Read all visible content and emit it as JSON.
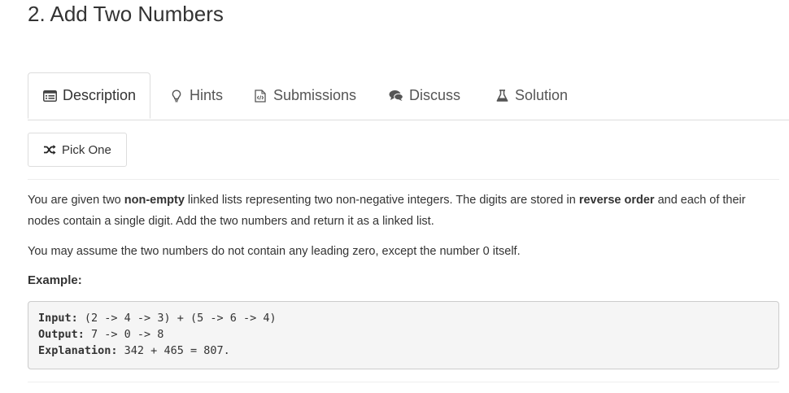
{
  "problem": {
    "title": "2. Add Two Numbers"
  },
  "tabs": [
    {
      "label": "Description",
      "icon": "list-icon",
      "active": true
    },
    {
      "label": "Hints",
      "icon": "lightbulb-icon"
    },
    {
      "label": "Submissions",
      "icon": "code-file-icon"
    },
    {
      "label": "Discuss",
      "icon": "chat-icon"
    },
    {
      "label": "Solution",
      "icon": "flask-icon"
    }
  ],
  "pick_one": {
    "label": "Pick One",
    "icon": "shuffle-icon"
  },
  "description": {
    "p1_a": "You are given two ",
    "p1_b": "non-empty",
    "p1_c": " linked lists representing two non-negative integers. The digits are stored in ",
    "p1_d": "reverse order",
    "p1_e": " and each of their nodes contain a single digit. Add the two numbers and return it as a linked list.",
    "p2": "You may assume the two numbers do not contain any leading zero, except the number 0 itself.",
    "example_heading": "Example:",
    "example": {
      "input_label": "Input:",
      "input_value": " (2 -> 4 -> 3) + (5 -> 6 -> 4)",
      "output_label": "Output:",
      "output_value": " 7 -> 0 -> 8",
      "explanation_label": "Explanation:",
      "explanation_value": " 342 + 465 = 807."
    }
  }
}
